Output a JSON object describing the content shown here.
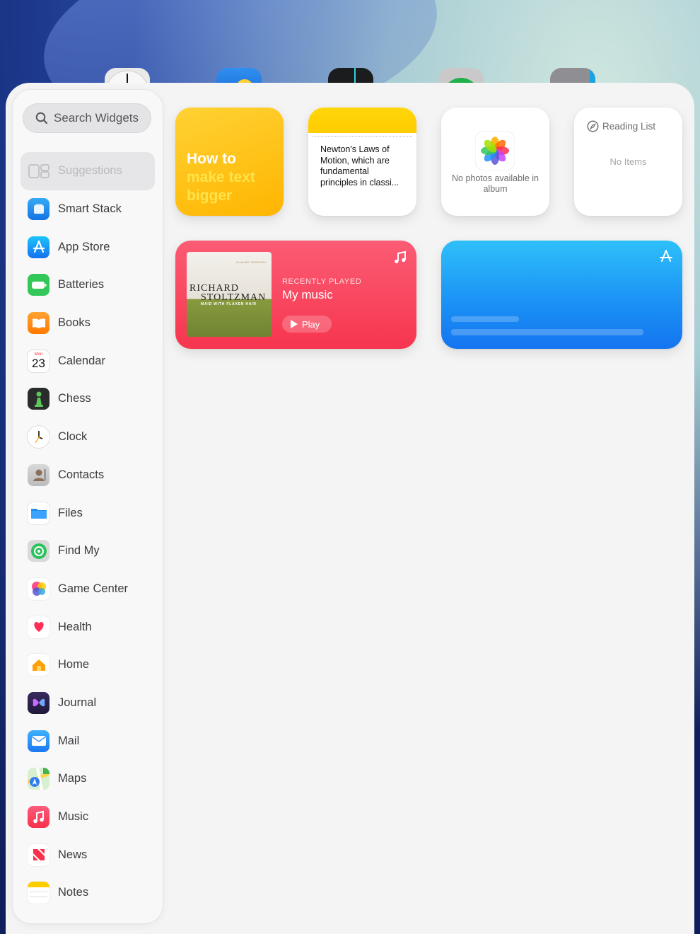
{
  "search": {
    "placeholder": "Search Widgets"
  },
  "sidebar": {
    "items": [
      {
        "label": "Suggestions",
        "icon": "suggestions-icon",
        "selected": true
      },
      {
        "label": "Smart Stack",
        "icon": "smart-stack-icon"
      },
      {
        "label": "App Store",
        "icon": "app-store-icon"
      },
      {
        "label": "Batteries",
        "icon": "battery-icon"
      },
      {
        "label": "Books",
        "icon": "books-icon"
      },
      {
        "label": "Calendar",
        "icon": "calendar-icon",
        "icon_day": "Mon",
        "icon_date": "23"
      },
      {
        "label": "Chess",
        "icon": "chess-icon"
      },
      {
        "label": "Clock",
        "icon": "clock-icon"
      },
      {
        "label": "Contacts",
        "icon": "contacts-icon"
      },
      {
        "label": "Files",
        "icon": "files-icon"
      },
      {
        "label": "Find My",
        "icon": "find-my-icon"
      },
      {
        "label": "Game Center",
        "icon": "game-center-icon"
      },
      {
        "label": "Health",
        "icon": "health-icon"
      },
      {
        "label": "Home",
        "icon": "home-icon"
      },
      {
        "label": "Journal",
        "icon": "journal-icon"
      },
      {
        "label": "Mail",
        "icon": "mail-icon"
      },
      {
        "label": "Maps",
        "icon": "maps-icon"
      },
      {
        "label": "Music",
        "icon": "music-icon"
      },
      {
        "label": "News",
        "icon": "news-icon"
      },
      {
        "label": "Notes",
        "icon": "notes-icon"
      }
    ]
  },
  "widgets": {
    "tips": {
      "line1": "How to",
      "line2": "make text",
      "line3": "bigger"
    },
    "notes": {
      "text": "Newton's Laws of Motion, which are fundamental principles in classi..."
    },
    "photos": {
      "caption": "No photos available in album"
    },
    "reading_list": {
      "title": "Reading List",
      "empty": "No Items"
    },
    "music": {
      "label": "RECENTLY PLAYED",
      "title": "My music",
      "play": "Play",
      "album_top": "CLAUDE DEBUSSY",
      "album_line1": "RICHARD",
      "album_line2": "STOLTZMAN",
      "album_line3": "MAID WITH FLAXEN HAIR"
    }
  },
  "colors": {
    "music_accent": "#f7354f",
    "tips_accent": "#ffc21a",
    "appstore_accent": "#1a8ff5"
  }
}
